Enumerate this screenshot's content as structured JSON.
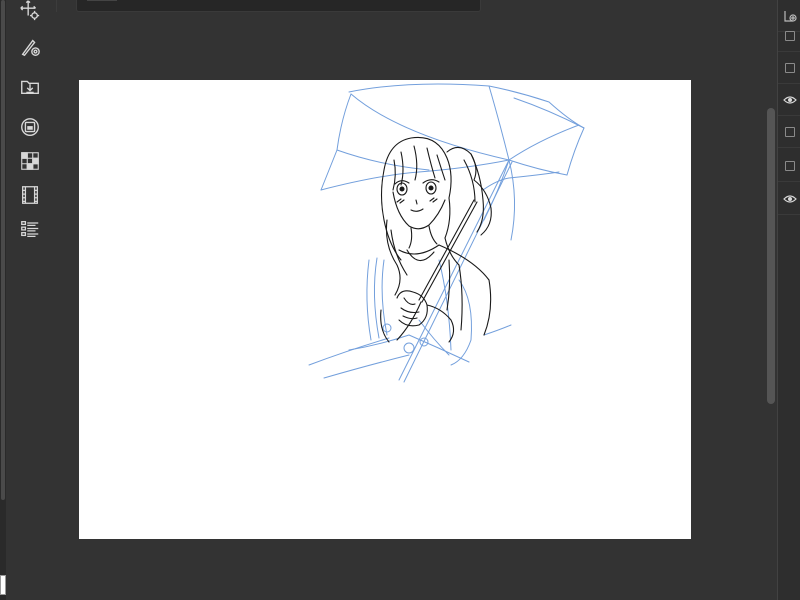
{
  "app": {
    "accent": "#ffffff",
    "background": "#333333",
    "canvas_color": "#ffffff"
  },
  "toolbar": {
    "tools": [
      {
        "name": "move-transform",
        "icon": "move-gear-icon"
      },
      {
        "name": "brush",
        "icon": "brush-target-icon"
      },
      {
        "name": "import",
        "icon": "import-folder-icon"
      },
      {
        "name": "layer-mask",
        "icon": "circle-square-icon"
      },
      {
        "name": "grid",
        "icon": "grid-icon"
      },
      {
        "name": "filmstrip",
        "icon": "film-icon"
      },
      {
        "name": "layer-list",
        "icon": "list-icon"
      }
    ]
  },
  "layers": [
    {
      "visible": false
    },
    {
      "visible": false
    },
    {
      "visible": false
    },
    {
      "visible": true
    },
    {
      "visible": false
    },
    {
      "visible": false
    },
    {
      "visible": true
    }
  ],
  "sketch": {
    "line_color": "#1a1a1a",
    "rough_color": "#5b8fd6"
  }
}
